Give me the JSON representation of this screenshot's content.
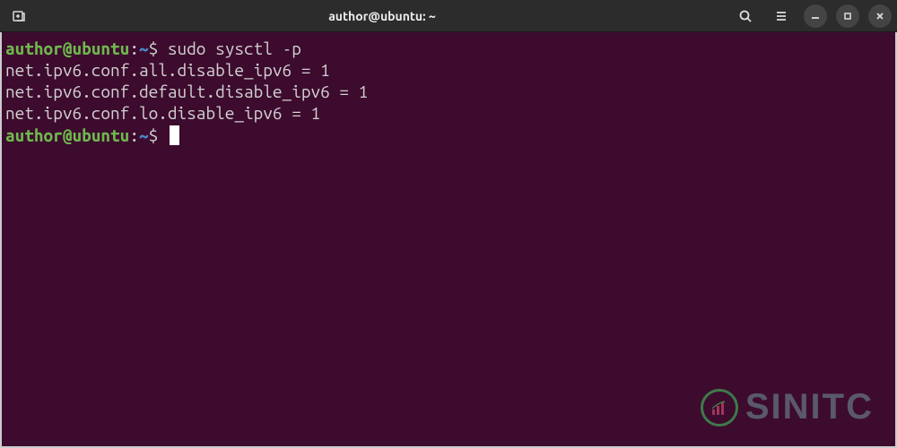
{
  "titlebar": {
    "title": "author@ubuntu: ~"
  },
  "terminal": {
    "prompt1": {
      "user_host": "author@ubuntu",
      "colon": ":",
      "path": "~",
      "dollar": "$"
    },
    "command1": "sudo sysctl -p",
    "output": [
      "net.ipv6.conf.all.disable_ipv6 = 1",
      "net.ipv6.conf.default.disable_ipv6 = 1",
      "net.ipv6.conf.lo.disable_ipv6 = 1"
    ],
    "prompt2": {
      "user_host": "author@ubuntu",
      "colon": ":",
      "path": "~",
      "dollar": "$"
    }
  },
  "watermark": {
    "text": "SINITC"
  }
}
